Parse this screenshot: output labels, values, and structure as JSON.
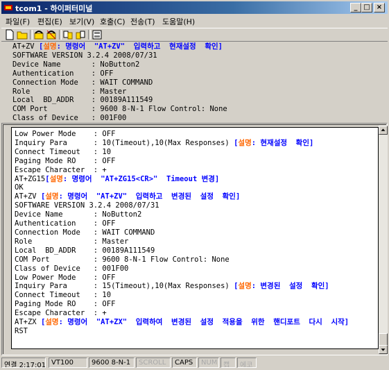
{
  "window": {
    "title": "tcom1 - 하이퍼터미널",
    "controls": [
      "_",
      "□",
      "×"
    ]
  },
  "menu": [
    "파일(F)",
    "편집(E)",
    "보기(V)",
    "호출(C)",
    "전송(T)",
    "도움말(H)"
  ],
  "toolbar": [
    "new",
    "open",
    "phone-dial",
    "phone-disconnect",
    "send-file",
    "receive-file",
    "properties"
  ],
  "top_pane": {
    "lines": [
      {
        "text": "AT+ZV ",
        "note": {
          "pre": "[",
          "kw": "설명",
          "body": ": 명령어  \"AT+ZV\"  입력하고  현재설정  확인]"
        }
      },
      {
        "text": "SOFTWARE VERSION 3.2.4 2008/07/31"
      },
      {
        "text": "Device Name       : NoButton2"
      },
      {
        "text": "Authentication    : OFF"
      },
      {
        "text": "Connection Mode   : WAIT COMMAND"
      },
      {
        "text": "Role              : Master"
      },
      {
        "text": "Local  BD_ADDR    : 00189A111549"
      },
      {
        "text": "COM Port          : 9600 8-N-1 Flow Control: None"
      },
      {
        "text": "Class of Device   : 001F00"
      }
    ]
  },
  "terminal": {
    "lines": [
      {
        "text": "Low Power Mode    : OFF"
      },
      {
        "text": "Inquiry Para      : 10(Timeout),10(Max Responses) ",
        "note": {
          "pre": "[",
          "kw": "설명",
          "body": ": 현재설정  확인]"
        }
      },
      {
        "text": "Connect Timeout   : 10"
      },
      {
        "text": "Paging Mode RO    : OFF"
      },
      {
        "text": "Escape Character  : +"
      },
      {
        "text": "AT+ZG15",
        "note": {
          "pre": "[",
          "kw": "설명",
          "body": ": 명령어  \"AT+ZG15<CR>\"  Timeout 변경]"
        }
      },
      {
        "text": "OK"
      },
      {
        "text": "AT+ZV ",
        "note": {
          "pre": "[",
          "kw": "설명",
          "body": ": 명령어  \"AT+ZV\"  입력하고  변경된  설정  확인]"
        }
      },
      {
        "text": "SOFTWARE VERSION 3.2.4 2008/07/31"
      },
      {
        "text": "Device Name       : NoButton2"
      },
      {
        "text": "Authentication    : OFF"
      },
      {
        "text": "Connection Mode   : WAIT COMMAND"
      },
      {
        "text": "Role              : Master"
      },
      {
        "text": "Local  BD_ADDR    : 00189A111549"
      },
      {
        "text": "COM Port          : 9600 8-N-1 Flow Control: None"
      },
      {
        "text": "Class of Device   : 001F00"
      },
      {
        "text": "Low Power Mode    : OFF"
      },
      {
        "text": "Inquiry Para      : 15(Timeout),10(Max Responses) ",
        "note": {
          "pre": "[",
          "kw": "설명",
          "body": ": 변경된  설정  확인]"
        }
      },
      {
        "text": "Connect Timeout   : 10"
      },
      {
        "text": "Paging Mode RO    : OFF"
      },
      {
        "text": "Escape Character  : +"
      },
      {
        "text": "AT+ZX ",
        "note": {
          "pre": "[",
          "kw": "설명",
          "body": ": 명령어  \"AT+ZX\"  입력하여  변경된  설정  적용을  위한  핸디포트  다시  시작]"
        }
      },
      {
        "text": "RST"
      }
    ]
  },
  "statusbar": {
    "connected": "연결 2:17:01",
    "emulation": "VT100",
    "settings": "9600 8-N-1",
    "scroll": "SCROLL",
    "caps": "CAPS",
    "num": "NUM",
    "capture": "캡",
    "echo": "에코"
  }
}
